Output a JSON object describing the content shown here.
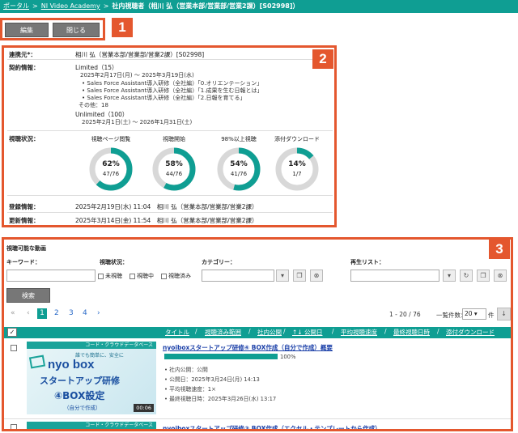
{
  "breadcrumb": {
    "portal": "ポータル",
    "sep": ">",
    "academy": "NI Video Academy",
    "title": "社内視聴者（相川 弘（営業本部/営業部/営業2課）[S02998]）"
  },
  "toolbar": {
    "edit": "編集",
    "close": "閉じる"
  },
  "badges": {
    "b1": "1",
    "b2": "2",
    "b3": "3"
  },
  "info": {
    "contact_label": "連携元*：",
    "contact_value": "相川 弘（営業本部/営業部/営業2課）[S02998]",
    "contract_label": "契約情報：",
    "limited": "Limited（15）",
    "limited_period": "2025年2月17日(月) ～ 2025年3月19日(水)",
    "courses": [
      "Sales Force Assistant導入研修（全社編）「0.オリエンテーション」",
      "Sales Force Assistant導入研修（全社編）「1.成果を生む日報とは」",
      "Sales Force Assistant導入研修（全社編）「2.日報を育てる」"
    ],
    "others": "その他：18",
    "unlimited": "Unlimited（100）",
    "unlimited_period": "2025年2月1日(土) ～ 2026年1月31日(土)",
    "status_label": "視聴状況：",
    "stats": [
      {
        "label": "視聴ページ閲覧",
        "pct": "62%",
        "frac": "47/76",
        "value": 0.62
      },
      {
        "label": "視聴開始",
        "pct": "58%",
        "frac": "44/76",
        "value": 0.58
      },
      {
        "label": "98%以上視聴",
        "pct": "54%",
        "frac": "41/76",
        "value": 0.54
      },
      {
        "label": "添付ダウンロード",
        "pct": "14%",
        "frac": "1/7",
        "value": 0.14
      }
    ],
    "reg_label": "登録情報：",
    "reg_value": "2025年2月19日(水) 11:04　相川 弘（営業本部/営業部/営業2課）",
    "upd_label": "更新情報：",
    "upd_value": "2025年3月14日(金) 11:54　相川 弘（営業本部/営業部/営業2課）"
  },
  "videos": {
    "heading": "視聴可能な動画",
    "keyword_label": "キーワード：",
    "status_label": "視聴状況：",
    "cat_label": "カテゴリー：",
    "playlist_label": "再生リスト：",
    "opt_unwatched": "未視聴",
    "opt_watching": "視聴中",
    "opt_watched": "視聴済み",
    "search_btn": "検索",
    "pages": [
      "1",
      "2",
      "3",
      "4"
    ],
    "first": "«",
    "prev": "‹",
    "next": "›",
    "range": "1 - 20 / 76",
    "per_page_label": "一覧件数：",
    "per_page": "20",
    "per_unit": "件",
    "columns": [
      "タイトル",
      "視聴済み範囲",
      "社内公開",
      "↑↓ 公開日",
      "平均視聴速度",
      "最終視聴日時",
      "添付ダウンロード"
    ],
    "items": [
      {
        "title": "nyoiboxスタートアップ研修④ BOX作成（自分で作成）概要",
        "progress": "100%",
        "progress_value": 1.0,
        "meta": [
          "社内公開：公開",
          "公開日：2025年3月24日(月) 14:13",
          "平均視聴速度：1×",
          "最終視聴日時：2025年3月26日(水) 13:17"
        ],
        "thumb_top": "コード・クラウドデータベース",
        "thumb_top2": "誰でも簡単に、安全に",
        "thumb_logo": "nyo box",
        "thumb_main": "スタートアップ研修",
        "thumb_sub": "④BOX設定",
        "thumb_sub2": "（自分で作成）",
        "duration": "00:06"
      },
      {
        "title": "nyoiboxスタートアップ研修③ BOX作成（エクセル・テンプレートから作成）",
        "thumb_top": "コード・クラウドデータベース"
      }
    ]
  },
  "colors": {
    "accent": "#0f9e93",
    "annot": "#e4572e",
    "track": "#d8d8d8"
  }
}
